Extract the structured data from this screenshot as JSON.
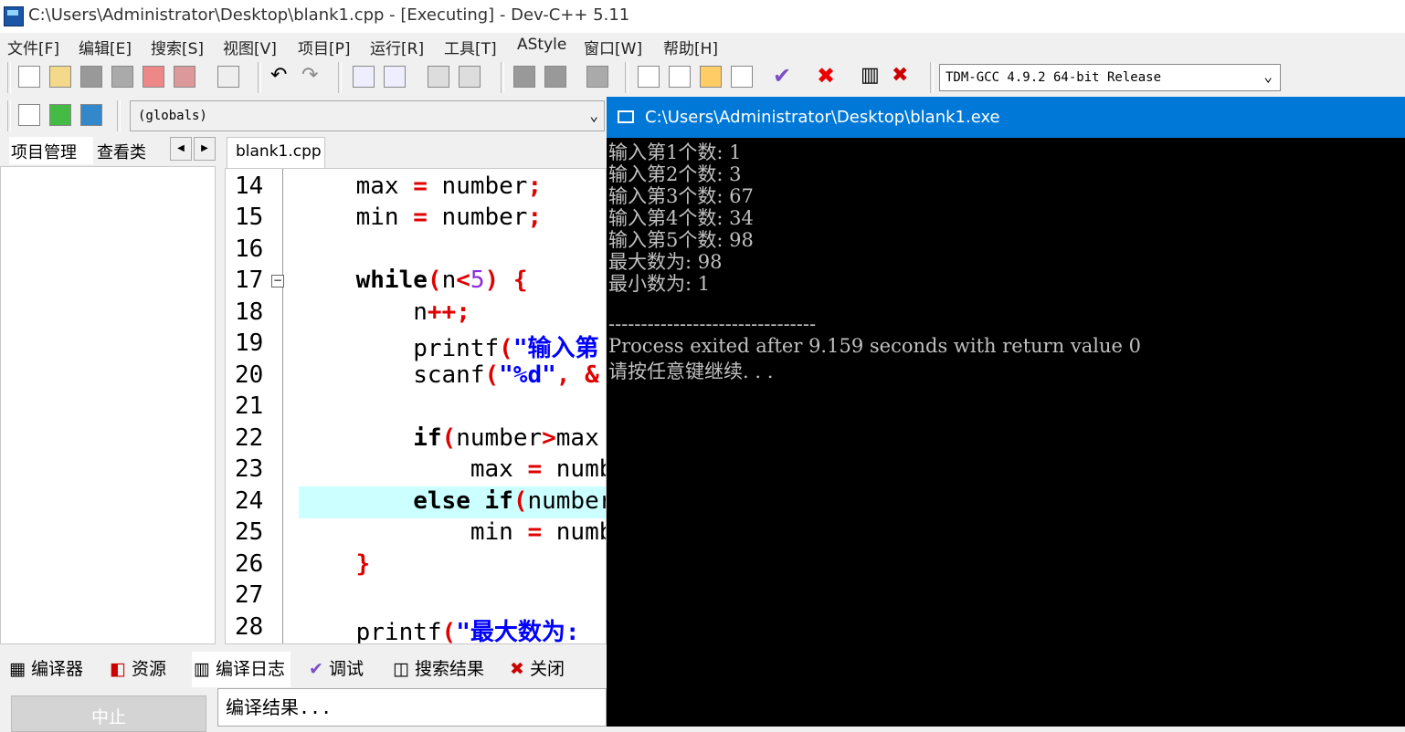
{
  "window": {
    "title": "C:\\Users\\Administrator\\Desktop\\blank1.cpp - [Executing] - Dev-C++ 5.11"
  },
  "menu": [
    "文件[F]",
    "编辑[E]",
    "搜索[S]",
    "视图[V]",
    "项目[P]",
    "运行[R]",
    "工具[T]",
    "AStyle",
    "窗口[W]",
    "帮助[H]"
  ],
  "toolbar": {
    "compiler": "TDM-GCC 4.9.2 64-bit Release",
    "scope": "(globals)"
  },
  "left_panel": {
    "tabs": [
      "项目管理",
      "查看类"
    ]
  },
  "editor": {
    "file_tab": "blank1.cpp",
    "line_numbers": [
      "14",
      "15",
      "16",
      "17",
      "18",
      "19",
      "20",
      "21",
      "22",
      "23",
      "24",
      "25",
      "26",
      "27",
      "28"
    ],
    "current_line": 24
  },
  "bottom": {
    "tabs": [
      "编译器",
      "资源",
      "编译日志",
      "调试",
      "搜索结果",
      "关闭"
    ],
    "stop_label": "中止",
    "log_text": "编译结果..."
  },
  "console": {
    "title": "C:\\Users\\Administrator\\Desktop\\blank1.exe",
    "lines": [
      "输入第1个数: 1",
      "输入第2个数: 3",
      "输入第3个数: 67",
      "输入第4个数: 34",
      "输入第5个数: 98",
      "最大数为: 98",
      "最小数为: 1",
      "",
      "--------------------------------",
      "Process exited after 9.159 seconds with return value 0",
      "请按任意键继续. . ."
    ]
  },
  "colors": {
    "console_title_bg": "#0078d7",
    "current_line_highlight": "#ccffff"
  }
}
